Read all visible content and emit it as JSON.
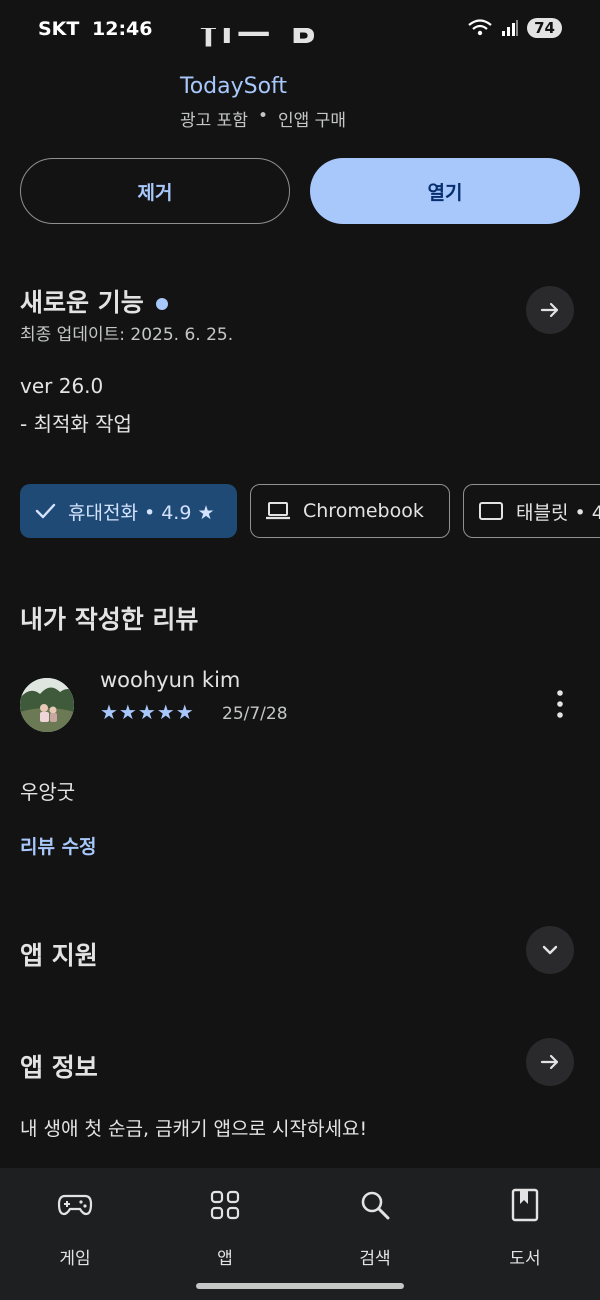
{
  "status_bar": {
    "carrier": "SKT",
    "time": "12:46",
    "battery": "74"
  },
  "app": {
    "title_clipped": "†ı— Б",
    "developer": "TodaySoft",
    "meta": [
      "광고 포함",
      "•",
      "인앱 구매"
    ]
  },
  "buttons": {
    "uninstall": "제거",
    "open": "열기"
  },
  "whats_new": {
    "title": "새로운 기능",
    "updated": "최종 업데이트: 2025. 6. 25.",
    "version": "ver 26.0",
    "notes": "- 최적화 작업"
  },
  "device_chips": [
    {
      "label": "휴대전화 • 4.9 ★",
      "selected": true,
      "icon": "check-icon"
    },
    {
      "label": "Chromebook",
      "selected": false,
      "icon": "laptop-icon"
    },
    {
      "label": "태블릿 • 4",
      "selected": false,
      "icon": "tablet-icon"
    }
  ],
  "my_review": {
    "title": "내가 작성한 리뷰",
    "reviewer": "woohyun kim",
    "stars": "★★★★★",
    "date": "25/7/28",
    "text": "우앙굿",
    "edit_link": "리뷰 수정"
  },
  "app_support": {
    "title": "앱 지원"
  },
  "app_info": {
    "title": "앱 정보",
    "description": "내 생애 첫 순금, 금캐기 앱으로 시작하세요!"
  },
  "bottom_nav": [
    {
      "label": "게임",
      "icon": "gamepad-icon"
    },
    {
      "label": "앱",
      "icon": "apps-grid-icon"
    },
    {
      "label": "검색",
      "icon": "search-icon"
    },
    {
      "label": "도서",
      "icon": "book-icon"
    }
  ],
  "colors": {
    "background": "#131314",
    "accent": "#a8c7fa",
    "chip_selected": "#1f4a75"
  }
}
